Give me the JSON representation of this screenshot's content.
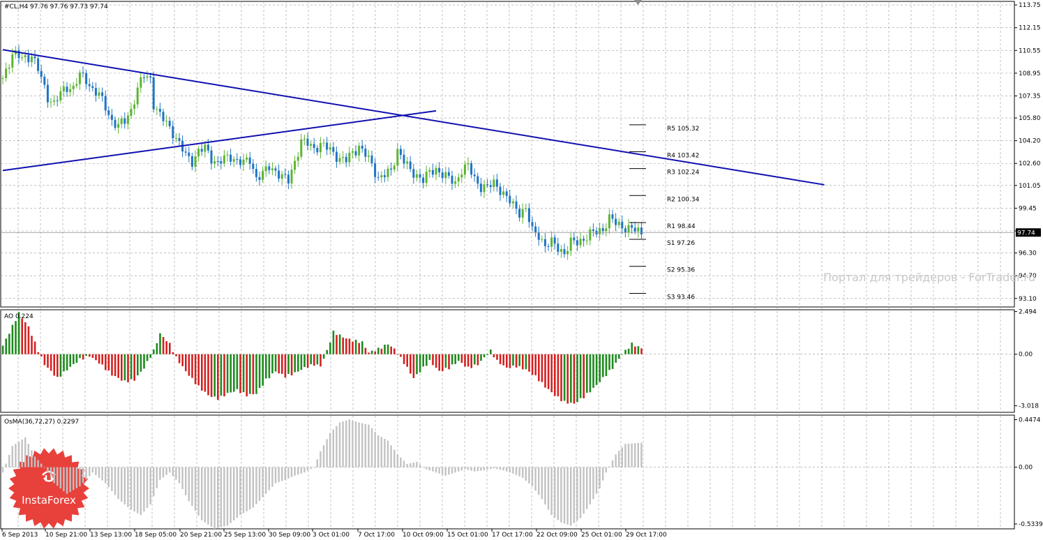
{
  "header": {
    "symbol_line": "#CL,H4  97.76 97.76 97.73 97.74"
  },
  "watermark": "Портал для трейдеров - ForTrader.ru",
  "logo": {
    "text": "InstaForex",
    "color": "#e8413c"
  },
  "colors": {
    "bull": "#5cb531",
    "bear": "#1f74c4",
    "trend": "#0f10b0",
    "ao_up": "#1e8a1e",
    "ao_down": "#d42020",
    "osma": "#c2c2c2",
    "grid": "#9a9a9a",
    "price_tag_bg": "#000000"
  },
  "chart_data": [
    {
      "type": "candlestick",
      "title": "#CL,H4  97.76 97.76 97.73 97.74",
      "ylim": [
        92.5,
        114.0
      ],
      "yticks": [
        "113.75",
        "112.15",
        "110.55",
        "108.95",
        "107.35",
        "105.80",
        "104.20",
        "102.60",
        "101.05",
        "99.45",
        "97.85",
        "96.30",
        "94.70",
        "93.10"
      ],
      "current_price": "97.74",
      "xticks": [
        "6 Sep 2013",
        "10 Sep 21:00",
        "13 Sep 13:00",
        "18 Sep 05:00",
        "20 Sep 21:00",
        "25 Sep 13:00",
        "30 Sep 09:00",
        "3 Oct 01:00",
        "7 Oct 17:00",
        "10 Oct 09:00",
        "15 Oct 01:00",
        "17 Oct 17:00",
        "22 Oct 09:00",
        "25 Oct 01:00",
        "29 Oct 17:00"
      ],
      "close_path": [
        [
          0,
          108.6
        ],
        [
          3,
          110.3
        ],
        [
          6,
          110.0
        ],
        [
          9,
          110.2
        ],
        [
          11,
          109.2
        ],
        [
          14,
          107.3
        ],
        [
          16,
          106.8
        ],
        [
          18,
          107.5
        ],
        [
          20,
          108.0
        ],
        [
          22,
          107.9
        ],
        [
          24,
          108.8
        ],
        [
          26,
          108.5
        ],
        [
          28,
          107.8
        ],
        [
          30,
          107.4
        ],
        [
          32,
          106.6
        ],
        [
          34,
          105.6
        ],
        [
          36,
          105.2
        ],
        [
          38,
          105.6
        ],
        [
          40,
          106.4
        ],
        [
          42,
          107.8
        ],
        [
          44,
          108.8
        ],
        [
          46,
          108.6
        ],
        [
          47,
          106.8
        ],
        [
          49,
          105.9
        ],
        [
          51,
          105.5
        ],
        [
          53,
          104.8
        ],
        [
          55,
          103.9
        ],
        [
          57,
          103.2
        ],
        [
          59,
          102.8
        ],
        [
          61,
          103.4
        ],
        [
          63,
          103.7
        ],
        [
          65,
          103.0
        ],
        [
          67,
          102.6
        ],
        [
          69,
          102.9
        ],
        [
          71,
          103.1
        ],
        [
          73,
          102.8
        ],
        [
          75,
          102.6
        ],
        [
          77,
          102.9
        ],
        [
          79,
          101.6
        ],
        [
          81,
          101.8
        ],
        [
          83,
          102.4
        ],
        [
          85,
          102.1
        ],
        [
          87,
          101.6
        ],
        [
          89,
          101.4
        ],
        [
          91,
          102.8
        ],
        [
          93,
          104.1
        ],
        [
          95,
          104.0
        ],
        [
          97,
          103.7
        ],
        [
          99,
          103.9
        ],
        [
          101,
          103.7
        ],
        [
          103,
          103.4
        ],
        [
          105,
          102.9
        ],
        [
          107,
          102.8
        ],
        [
          109,
          103.4
        ],
        [
          111,
          103.8
        ],
        [
          113,
          103.2
        ],
        [
          115,
          102.5
        ],
        [
          117,
          101.6
        ],
        [
          119,
          101.8
        ],
        [
          121,
          102.0
        ],
        [
          123,
          103.6
        ],
        [
          125,
          102.8
        ],
        [
          127,
          102.0
        ],
        [
          129,
          101.8
        ],
        [
          131,
          101.5
        ],
        [
          133,
          101.9
        ],
        [
          135,
          102.2
        ],
        [
          137,
          101.9
        ],
        [
          139,
          101.5
        ],
        [
          141,
          101.2
        ],
        [
          143,
          102.2
        ],
        [
          145,
          102.4
        ],
        [
          147,
          101.5
        ],
        [
          149,
          101.0
        ],
        [
          151,
          100.9
        ],
        [
          153,
          101.2
        ],
        [
          155,
          100.8
        ],
        [
          157,
          100.2
        ],
        [
          159,
          99.6
        ],
        [
          161,
          99.2
        ],
        [
          163,
          99.4
        ],
        [
          165,
          97.8
        ],
        [
          167,
          97.6
        ],
        [
          169,
          96.8
        ],
        [
          171,
          97.0
        ],
        [
          173,
          96.7
        ],
        [
          175,
          96.3
        ],
        [
          177,
          97.0
        ],
        [
          179,
          97.1
        ],
        [
          181,
          97.3
        ],
        [
          183,
          97.6
        ],
        [
          185,
          97.8
        ],
        [
          187,
          98.0
        ],
        [
          189,
          98.7
        ],
        [
          191,
          98.4
        ],
        [
          193,
          98.2
        ],
        [
          195,
          98.0
        ],
        [
          197,
          97.9
        ],
        [
          199,
          97.74
        ]
      ],
      "trendlines": [
        {
          "from": [
            0,
            110.6
          ],
          "to": [
            256,
            101.1
          ]
        },
        {
          "from": [
            0,
            102.1
          ],
          "to": [
            135,
            106.3
          ]
        }
      ],
      "pivots": [
        {
          "label": "R5 105.32",
          "value": 105.32
        },
        {
          "label": "R4 103.42",
          "value": 103.42
        },
        {
          "label": "R3 102.24",
          "value": 102.24
        },
        {
          "label": "R2 100.34",
          "value": 100.34
        },
        {
          "label": "R1 98.44",
          "value": 98.44
        },
        {
          "label": "S1 97.26",
          "value": 97.26
        },
        {
          "label": "S2 95.36",
          "value": 95.36
        },
        {
          "label": "S3 93.46",
          "value": 93.46
        }
      ]
    },
    {
      "type": "bar",
      "title": "AO 0.224",
      "ylim": [
        -3.4,
        2.6
      ],
      "yticks": [
        "2.494",
        "0.00",
        "-3.018"
      ],
      "path": [
        [
          0,
          0.5
        ],
        [
          5,
          2.4
        ],
        [
          8,
          1.6
        ],
        [
          11,
          0.2
        ],
        [
          13,
          -0.6
        ],
        [
          17,
          -1.4
        ],
        [
          20,
          -0.9
        ],
        [
          24,
          -0.3
        ],
        [
          27,
          -0.1
        ],
        [
          30,
          -0.5
        ],
        [
          34,
          -1.2
        ],
        [
          38,
          -1.6
        ],
        [
          41,
          -1.5
        ],
        [
          44,
          -0.8
        ],
        [
          47,
          0.2
        ],
        [
          49,
          1.2
        ],
        [
          52,
          0.6
        ],
        [
          54,
          -0.2
        ],
        [
          57,
          -1.0
        ],
        [
          61,
          -1.9
        ],
        [
          64,
          -2.4
        ],
        [
          67,
          -2.6
        ],
        [
          70,
          -2.3
        ],
        [
          73,
          -2.1
        ],
        [
          76,
          -2.4
        ],
        [
          79,
          -2.3
        ],
        [
          82,
          -1.5
        ],
        [
          85,
          -1.0
        ],
        [
          88,
          -1.3
        ],
        [
          91,
          -1.1
        ],
        [
          94,
          -0.8
        ],
        [
          97,
          -0.6
        ],
        [
          99,
          -0.7
        ],
        [
          101,
          0.2
        ],
        [
          103,
          1.3
        ],
        [
          106,
          1.0
        ],
        [
          109,
          0.8
        ],
        [
          112,
          0.7
        ],
        [
          114,
          0.1
        ],
        [
          117,
          0.3
        ],
        [
          120,
          0.6
        ],
        [
          122,
          0.3
        ],
        [
          125,
          -0.5
        ],
        [
          128,
          -1.4
        ],
        [
          130,
          -1.0
        ],
        [
          133,
          -0.4
        ],
        [
          136,
          -1.0
        ],
        [
          139,
          -0.8
        ],
        [
          142,
          -0.4
        ],
        [
          145,
          -0.8
        ],
        [
          148,
          -0.6
        ],
        [
          150,
          -0.2
        ],
        [
          152,
          0.2
        ],
        [
          154,
          -0.4
        ],
        [
          157,
          -0.8
        ],
        [
          160,
          -0.7
        ],
        [
          163,
          -0.9
        ],
        [
          166,
          -1.3
        ],
        [
          169,
          -1.9
        ],
        [
          172,
          -2.4
        ],
        [
          175,
          -2.8
        ],
        [
          178,
          -2.9
        ],
        [
          181,
          -2.5
        ],
        [
          184,
          -2.0
        ],
        [
          187,
          -1.4
        ],
        [
          190,
          -0.8
        ],
        [
          193,
          0.0
        ],
        [
          196,
          0.6
        ],
        [
          199,
          0.35
        ]
      ]
    },
    {
      "type": "bar",
      "title": "OsMA(36,72,27) 0.2297",
      "ylim": [
        -0.58,
        0.49
      ],
      "yticks": [
        "0.4474",
        "0.00",
        "-0.5339"
      ],
      "path": [
        [
          0,
          -0.05
        ],
        [
          3,
          0.2
        ],
        [
          7,
          0.28
        ],
        [
          10,
          0.1
        ],
        [
          13,
          0.0
        ],
        [
          16,
          -0.15
        ],
        [
          20,
          -0.25
        ],
        [
          24,
          -0.18
        ],
        [
          28,
          -0.05
        ],
        [
          32,
          -0.15
        ],
        [
          36,
          -0.3
        ],
        [
          40,
          -0.4
        ],
        [
          43,
          -0.45
        ],
        [
          46,
          -0.35
        ],
        [
          49,
          -0.12
        ],
        [
          52,
          -0.05
        ],
        [
          55,
          -0.15
        ],
        [
          58,
          -0.32
        ],
        [
          62,
          -0.5
        ],
        [
          66,
          -0.58
        ],
        [
          70,
          -0.55
        ],
        [
          74,
          -0.45
        ],
        [
          78,
          -0.38
        ],
        [
          82,
          -0.25
        ],
        [
          85,
          -0.15
        ],
        [
          88,
          -0.12
        ],
        [
          91,
          -0.08
        ],
        [
          94,
          -0.05
        ],
        [
          97,
          0.0
        ],
        [
          99,
          0.15
        ],
        [
          102,
          0.32
        ],
        [
          105,
          0.42
        ],
        [
          108,
          0.45
        ],
        [
          111,
          0.42
        ],
        [
          114,
          0.4
        ],
        [
          117,
          0.3
        ],
        [
          120,
          0.25
        ],
        [
          123,
          0.12
        ],
        [
          126,
          0.03
        ],
        [
          129,
          0.05
        ],
        [
          132,
          -0.02
        ],
        [
          135,
          -0.05
        ],
        [
          138,
          -0.08
        ],
        [
          141,
          -0.05
        ],
        [
          144,
          -0.02
        ],
        [
          147,
          -0.04
        ],
        [
          150,
          -0.03
        ],
        [
          153,
          -0.01
        ],
        [
          156,
          -0.03
        ],
        [
          159,
          -0.06
        ],
        [
          162,
          -0.1
        ],
        [
          165,
          -0.18
        ],
        [
          168,
          -0.3
        ],
        [
          171,
          -0.45
        ],
        [
          174,
          -0.52
        ],
        [
          177,
          -0.55
        ],
        [
          180,
          -0.48
        ],
        [
          183,
          -0.35
        ],
        [
          186,
          -0.2
        ],
        [
          188,
          -0.05
        ],
        [
          191,
          0.12
        ],
        [
          194,
          0.22
        ],
        [
          199,
          0.2297
        ]
      ]
    }
  ]
}
